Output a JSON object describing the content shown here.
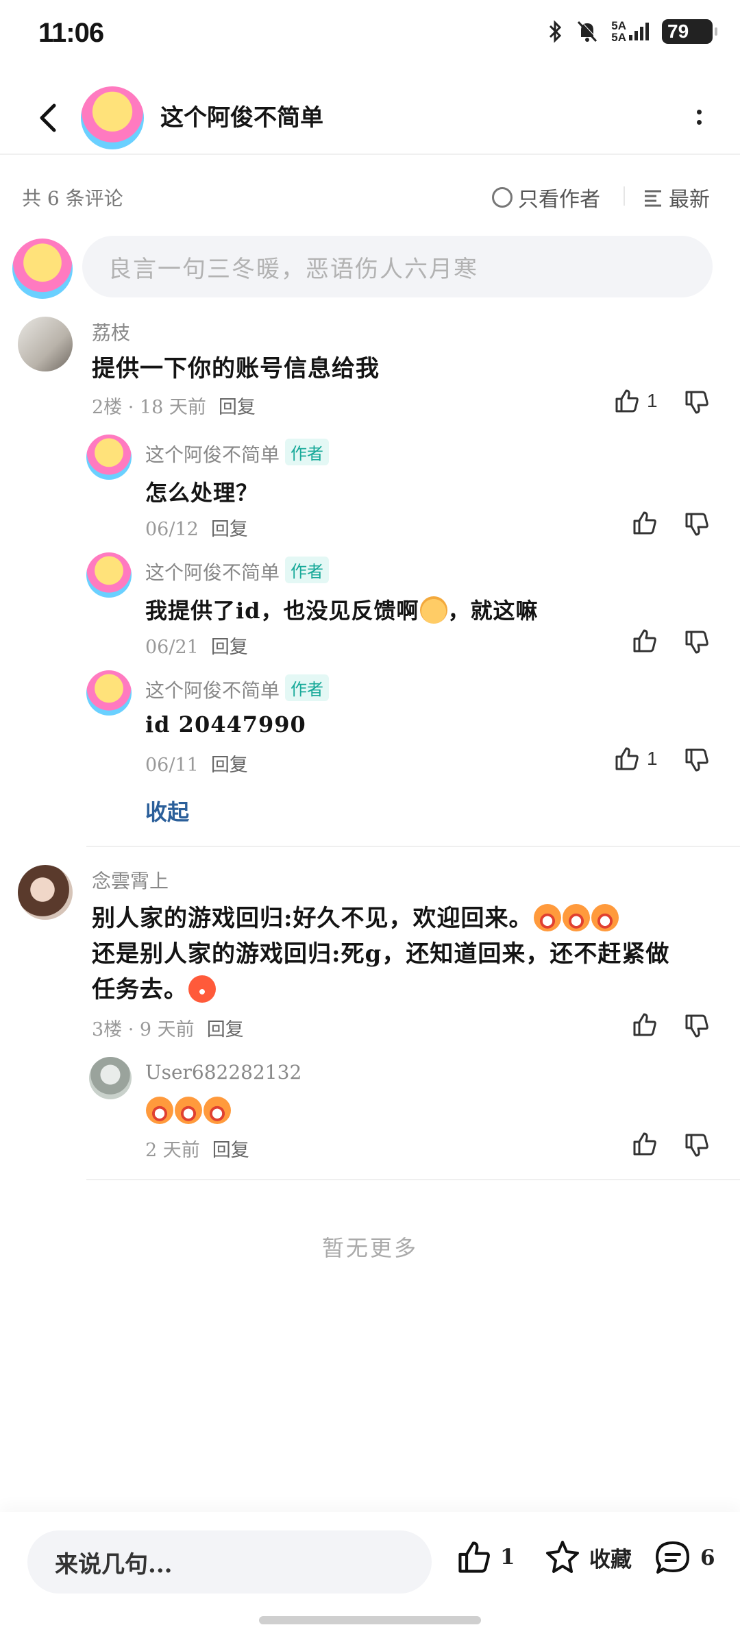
{
  "status_bar": {
    "time": "11:06",
    "battery": "79",
    "network": "5A"
  },
  "header": {
    "title": "这个阿俊不简单"
  },
  "filter": {
    "count_label": "共 6 条评论",
    "only_author": "只看作者",
    "sort": "最新"
  },
  "composer": {
    "placeholder": "良言一句三冬暖，恶语伤人六月寒"
  },
  "comments": [
    {
      "user": "荔枝",
      "text": "提供一下你的账号信息给我",
      "meta": "2楼 · 18 天前",
      "reply": "回复",
      "likes": "1",
      "replies": [
        {
          "user": "这个阿俊不简单",
          "tag": "作者",
          "text": "怎么处理？",
          "date": "06/12",
          "reply": "回复",
          "likes": ""
        },
        {
          "user": "这个阿俊不简单",
          "tag": "作者",
          "text_a": "我提供了id，也没见反馈啊",
          "text_b": "，就这嘛",
          "date": "06/21",
          "reply": "回复",
          "likes": ""
        },
        {
          "user": "这个阿俊不简单",
          "tag": "作者",
          "text": "id 20447990",
          "date": "06/11",
          "reply": "回复",
          "likes": "1"
        }
      ],
      "collapse": "收起"
    },
    {
      "user": "念雲霄上",
      "line1": "别人家的游戏回归:好久不见，欢迎回来。",
      "line2": "还是别人家的游戏回归:死g，还知道回来，还不赶紧做",
      "line3": "任务去。",
      "meta": "3楼 · 9 天前",
      "reply": "回复",
      "likes": "",
      "replies": [
        {
          "user": "User682282132",
          "date": "2 天前",
          "reply": "回复",
          "likes": ""
        }
      ]
    }
  ],
  "no_more": "暂无更多",
  "bottom_bar": {
    "placeholder": "来说几句...",
    "like_count": "1",
    "favorite": "收藏",
    "comment_count": "6"
  }
}
